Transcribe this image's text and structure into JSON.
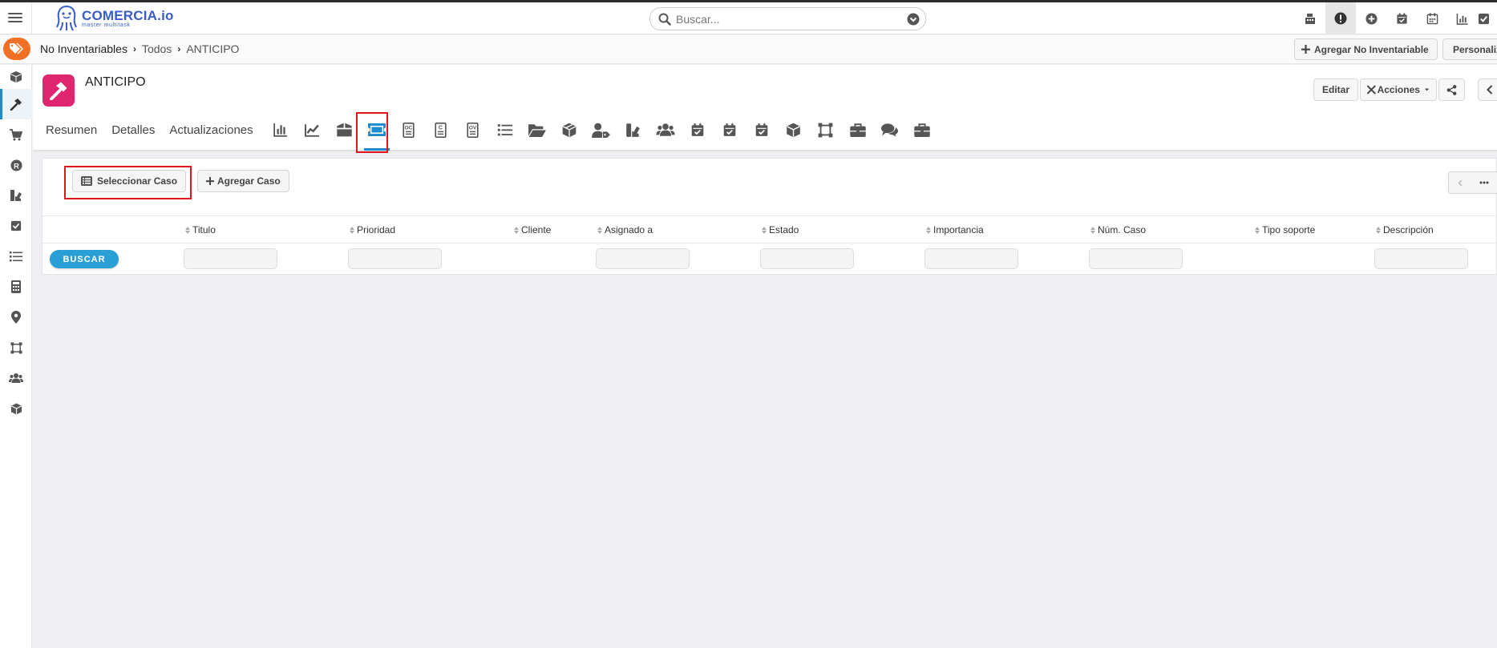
{
  "app": {
    "logo_text": "COMERCIA.io",
    "logo_tagline": "master multitask"
  },
  "search": {
    "placeholder": "Buscar..."
  },
  "top_icons": [
    "cash-register-icon",
    "alert-icon",
    "plus-circle-icon",
    "calendar-check-icon",
    "calendar-icon",
    "chart-bar-icon",
    "check-square-icon"
  ],
  "breadcrumb": {
    "items": [
      "No Inventariables",
      "Todos",
      "ANTICIPO"
    ]
  },
  "header_buttons": {
    "add": "Agregar No Inventariable",
    "customize": "Personalizar"
  },
  "record": {
    "title": "ANTICIPO",
    "edit_label": "Editar",
    "actions_label": "Acciones"
  },
  "tabs": {
    "text": [
      "Resumen",
      "Detalles",
      "Actualizaciones"
    ],
    "icons": [
      "chart-bar-icon",
      "chart-line-icon",
      "box-open-icon",
      "ticket-icon",
      "oc-doc-icon",
      "c-doc-icon",
      "ov-doc-icon",
      "list-icon",
      "folder-open-icon",
      "boxes-icon",
      "user-tag-icon",
      "swatch-icon",
      "users-icon",
      "calendar-check-icon",
      "calendar-check-icon",
      "calendar-check-icon",
      "cube-icon",
      "vector-square-icon",
      "briefcase-icon",
      "comments-icon",
      "toolbox-icon"
    ],
    "active_index": 3
  },
  "panel": {
    "select_case_label": "Seleccionar Caso",
    "add_case_label": "Agregar Caso",
    "search_button": "BUSCAR",
    "columns": [
      "Titulo",
      "Prioridad",
      "Cliente",
      "Asignado a",
      "Estado",
      "Importancia",
      "Núm. Caso",
      "Tipo soporte",
      "Descripción"
    ]
  },
  "sidebar": {
    "items": [
      "boxes-icon",
      "hammer-icon",
      "cart-icon",
      "r-circle-icon",
      "swatch-icon",
      "check-square-icon",
      "list-icon",
      "calculator-icon",
      "map-marker-icon",
      "vector-square-icon",
      "users-icon",
      "cube-icon"
    ],
    "active_index": 1
  },
  "colors": {
    "accent": "#1b8ccf",
    "record_icon_bg": "#e0256f",
    "breadcrumb_badge": "#f07025",
    "search_button": "#2a9fd6",
    "highlight": "#e0141e"
  }
}
